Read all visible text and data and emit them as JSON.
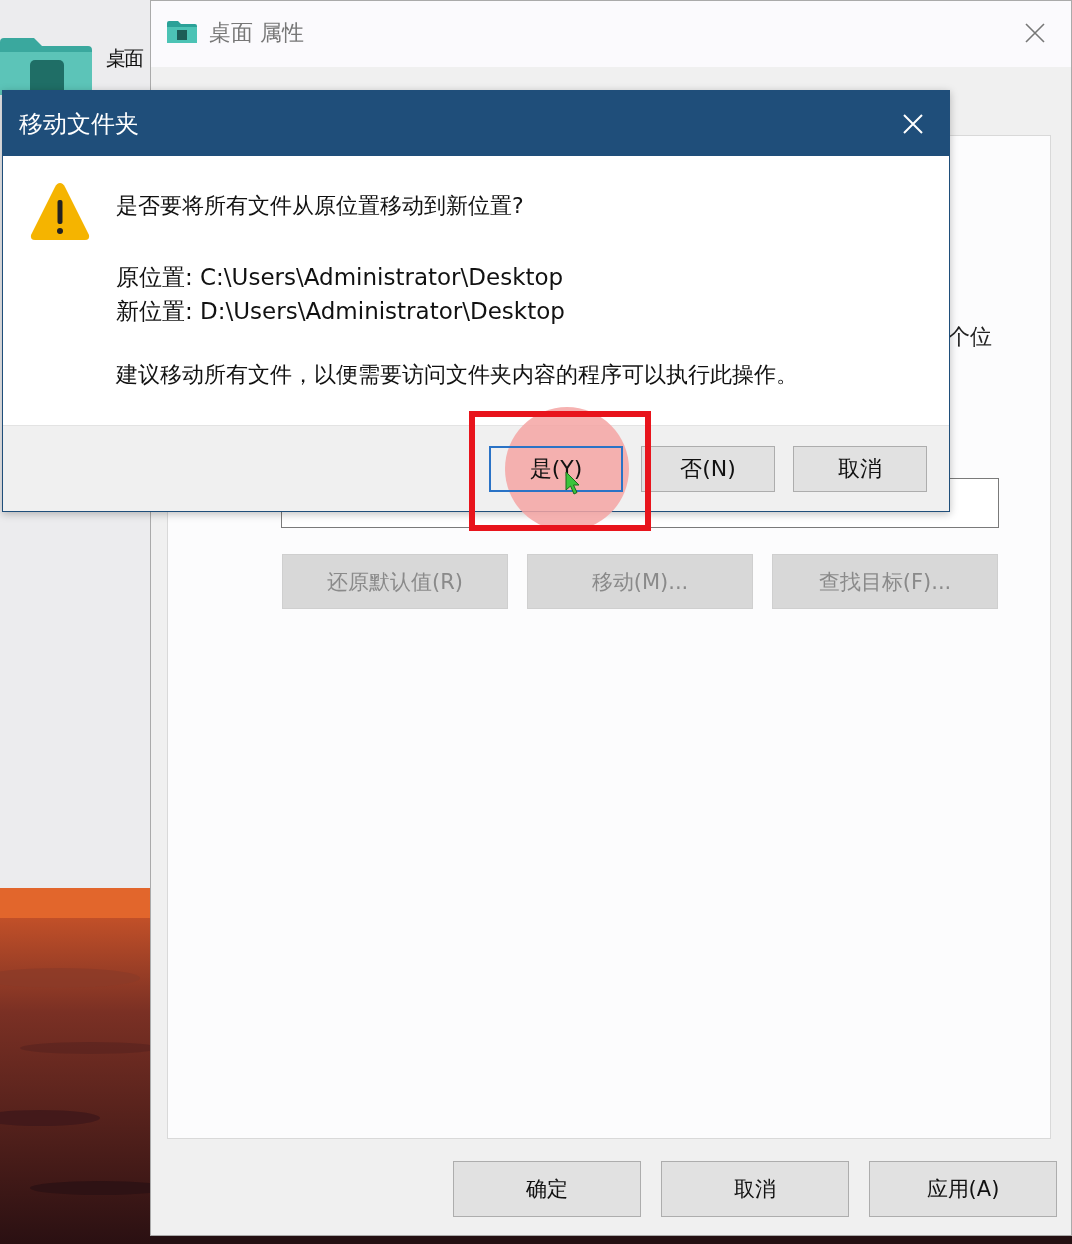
{
  "desktop": {
    "folder_label": "桌面"
  },
  "properties_window": {
    "title": "桌面 属性",
    "partial_text": "个位",
    "buttons": [
      {
        "label": "还原默认值(R)",
        "disabled": true
      },
      {
        "label": "移动(M)...",
        "disabled": true
      },
      {
        "label": "查找目标(F)...",
        "disabled": true
      }
    ],
    "footer_buttons": [
      {
        "label": "确定",
        "disabled": false
      },
      {
        "label": "取消",
        "disabled": false
      },
      {
        "label": "应用(A)",
        "disabled": false
      }
    ]
  },
  "dialog": {
    "title": "移动文件夹",
    "question": "是否要将所有文件从原位置移动到新位置?",
    "locations": [
      {
        "label": "原位置:",
        "path": "C:\\Users\\Administrator\\Desktop"
      },
      {
        "label": "新位置:",
        "path": "D:\\Users\\Administrator\\Desktop"
      }
    ],
    "advice": "建议移动所有文件，以便需要访问文件夹内容的程序可以执行此操作。",
    "buttons": [
      {
        "label": "是(Y)",
        "selected": true,
        "highlighted": true
      },
      {
        "label": "否(N)",
        "selected": false,
        "highlighted": false
      },
      {
        "label": "取消",
        "selected": false,
        "highlighted": false
      }
    ]
  }
}
